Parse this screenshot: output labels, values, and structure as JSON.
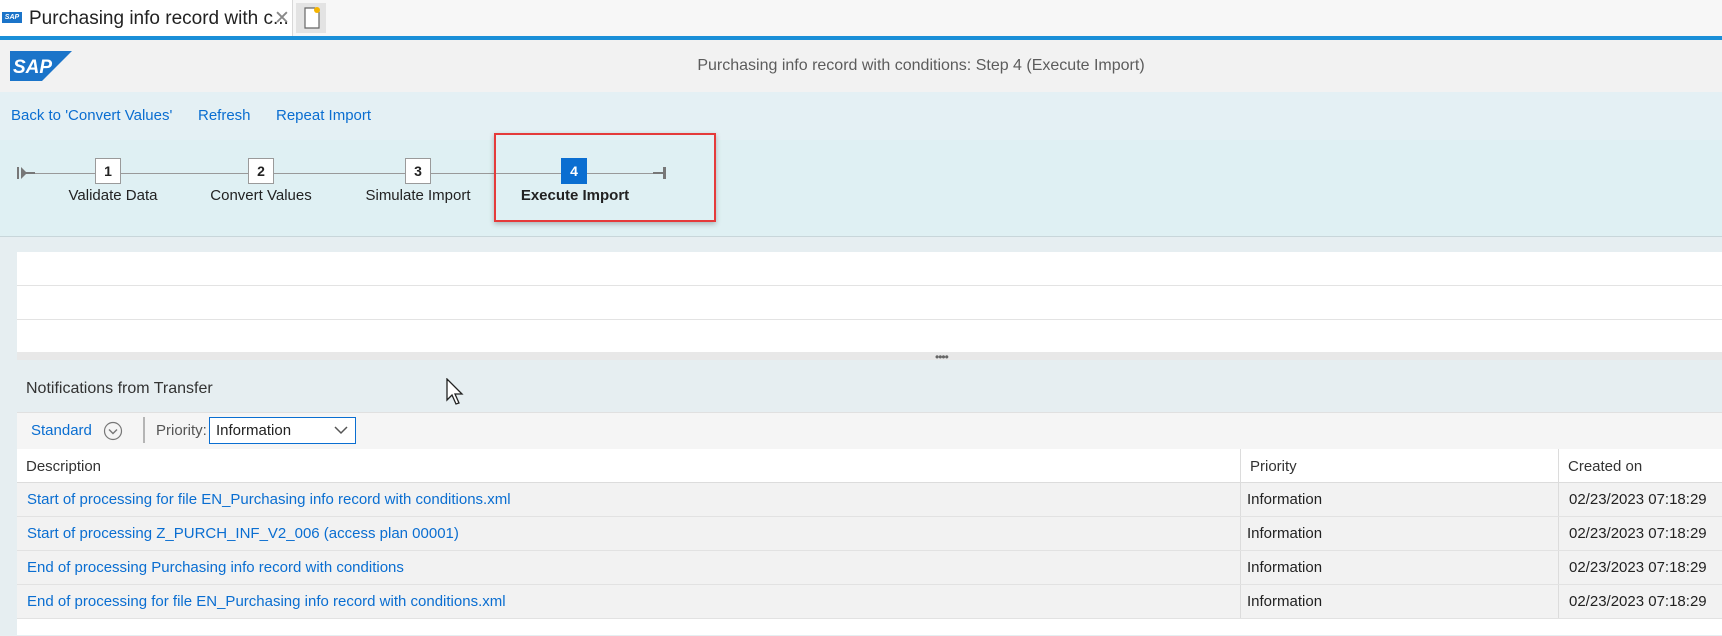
{
  "browser": {
    "tab_title": "Purchasing info record with c...",
    "favicon_text": "SAP",
    "close_glyph": "✕"
  },
  "shell": {
    "logo_text": "SAP",
    "page_title": "Purchasing info record with conditions: Step 4  (Execute Import)",
    "accent_color": "#1a8fd8",
    "logo_color": "#1b74c9"
  },
  "toolbar": {
    "back_label": "Back to 'Convert Values'",
    "refresh_label": "Refresh",
    "repeat_label": "Repeat Import"
  },
  "roadmap": {
    "steps": [
      {
        "number": "1",
        "label": "Validate Data"
      },
      {
        "number": "2",
        "label": "Convert Values"
      },
      {
        "number": "3",
        "label": "Simulate Import"
      },
      {
        "number": "4",
        "label": "Execute Import",
        "active": true
      }
    ],
    "active_color": "#0a6ed1",
    "highlight_color": "#e53a3a"
  },
  "notifications": {
    "title": "Notifications from Transfer",
    "variant_label": "Standard",
    "priority_label": "Priority:",
    "priority_value": "Information",
    "columns": [
      "Description",
      "Priority",
      "Created on"
    ],
    "rows": [
      {
        "description": "Start of processing for file EN_Purchasing info record with conditions.xml",
        "priority": "Information",
        "created_on": "02/23/2023 07:18:29"
      },
      {
        "description": "Start of processing Z_PURCH_INF_V2_006 (access plan 00001)",
        "priority": "Information",
        "created_on": "02/23/2023 07:18:29"
      },
      {
        "description": "End of processing Purchasing info record with conditions",
        "priority": "Information",
        "created_on": "02/23/2023 07:18:29"
      },
      {
        "description": "End of processing for file EN_Purchasing info record with conditions.xml",
        "priority": "Information",
        "created_on": "02/23/2023 07:18:29"
      }
    ]
  }
}
